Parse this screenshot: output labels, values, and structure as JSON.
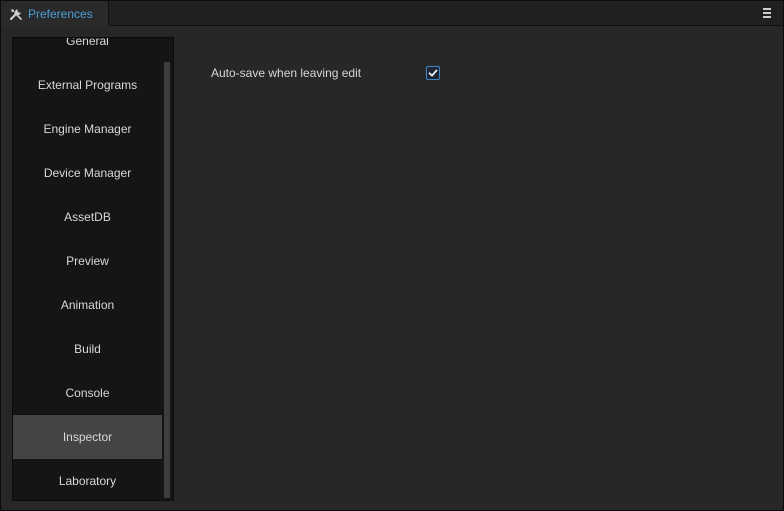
{
  "tab": {
    "title": "Preferences",
    "icon": "tools-icon"
  },
  "header": {
    "menu_icon": "hamburger-menu-icon"
  },
  "sidebar": {
    "items": [
      {
        "label": "General"
      },
      {
        "label": "External Programs"
      },
      {
        "label": "Engine Manager"
      },
      {
        "label": "Device Manager"
      },
      {
        "label": "AssetDB"
      },
      {
        "label": "Preview"
      },
      {
        "label": "Animation"
      },
      {
        "label": "Build"
      },
      {
        "label": "Console"
      },
      {
        "label": "Inspector",
        "selected": true
      },
      {
        "label": "Laboratory"
      }
    ]
  },
  "main": {
    "settings": [
      {
        "label": "Auto-save when leaving edit",
        "checked": true
      }
    ]
  },
  "colors": {
    "accent": "#4a9fd8",
    "selected_bg": "#444444",
    "panel_bg": "#272727",
    "sidebar_bg": "#151515"
  }
}
